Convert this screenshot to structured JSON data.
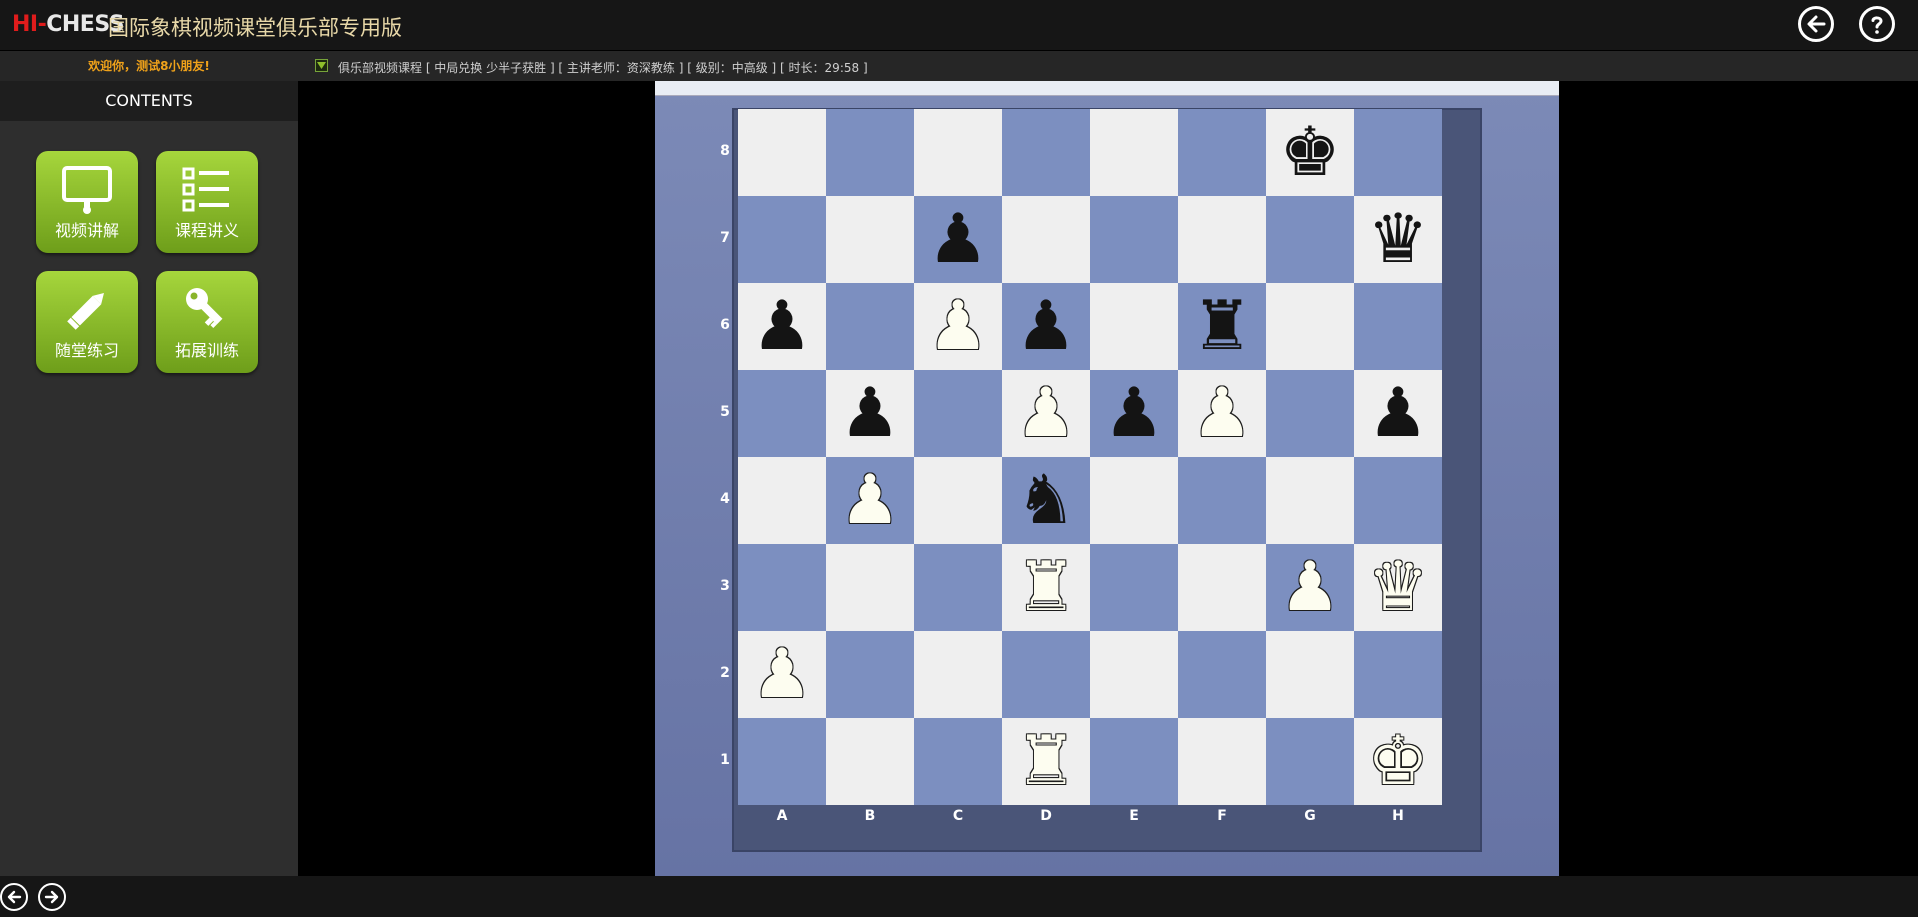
{
  "app": {
    "logo_hi": "HI",
    "logo_dash": "-",
    "logo_chess": "CHESS",
    "title": "国际象棋视频课堂俱乐部专用版"
  },
  "top_icons": {
    "back": "back-arrow-icon",
    "help": "help-icon"
  },
  "sidebar": {
    "welcome": "欢迎你，测试8小朋友!",
    "contents_label": "CONTENTS",
    "tiles": [
      {
        "label": "视频讲解",
        "icon": "monitor-icon"
      },
      {
        "label": "课程讲义",
        "icon": "list-icon"
      },
      {
        "label": "随堂练习",
        "icon": "pencil-icon"
      },
      {
        "label": "拓展训练",
        "icon": "key-icon"
      }
    ]
  },
  "course_bar": {
    "info": "俱乐部视频课程 [ 中局兑换 少半子获胜 ] [ 主讲老师：资深教练 ] [ 级别：中高级 ] [ 时长：29:58 ]"
  },
  "board": {
    "ranks": [
      "8",
      "7",
      "6",
      "5",
      "4",
      "3",
      "2",
      "1"
    ],
    "files": [
      "A",
      "B",
      "C",
      "D",
      "E",
      "F",
      "G",
      "H"
    ],
    "pieces": [
      {
        "square": "g8",
        "type": "king",
        "color": "black"
      },
      {
        "square": "h7",
        "type": "queen",
        "color": "black"
      },
      {
        "square": "c7",
        "type": "pawn",
        "color": "black"
      },
      {
        "square": "a6",
        "type": "pawn",
        "color": "black"
      },
      {
        "square": "c6",
        "type": "pawn",
        "color": "white"
      },
      {
        "square": "d6",
        "type": "pawn",
        "color": "black"
      },
      {
        "square": "f6",
        "type": "rook",
        "color": "black"
      },
      {
        "square": "b5",
        "type": "pawn",
        "color": "black"
      },
      {
        "square": "d5",
        "type": "pawn",
        "color": "white"
      },
      {
        "square": "e5",
        "type": "pawn",
        "color": "black"
      },
      {
        "square": "f5",
        "type": "pawn",
        "color": "white"
      },
      {
        "square": "h5",
        "type": "pawn",
        "color": "black"
      },
      {
        "square": "b4",
        "type": "pawn",
        "color": "white"
      },
      {
        "square": "d4",
        "type": "knight",
        "color": "black"
      },
      {
        "square": "d3",
        "type": "rook",
        "color": "white"
      },
      {
        "square": "g3",
        "type": "pawn",
        "color": "white"
      },
      {
        "square": "h3",
        "type": "queen",
        "color": "white"
      },
      {
        "square": "a2",
        "type": "pawn",
        "color": "white"
      },
      {
        "square": "d1",
        "type": "rook",
        "color": "white"
      },
      {
        "square": "h1",
        "type": "king",
        "color": "white"
      }
    ]
  },
  "bottom_nav": {
    "prev": "prev-arrow-icon",
    "next": "next-arrow-icon"
  },
  "colors": {
    "accent_green": "#8fc02b",
    "welcome_orange": "#f0a21a",
    "board_dark": "#7c8fc0",
    "board_light": "#efefef"
  }
}
